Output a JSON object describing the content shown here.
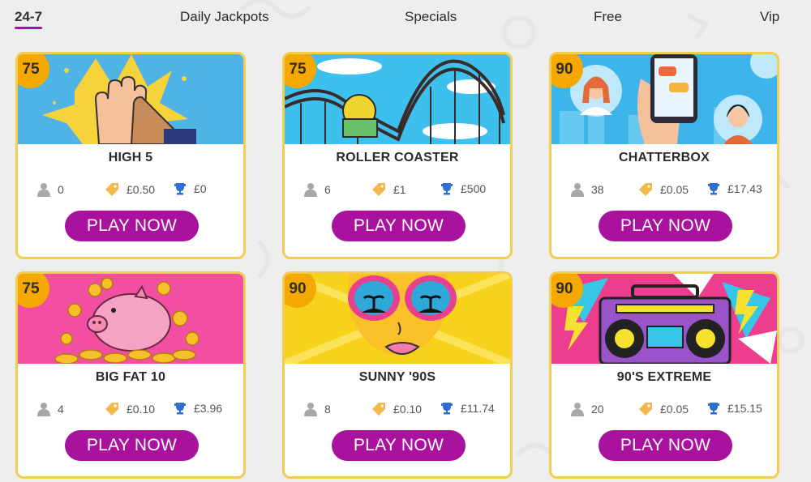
{
  "nav": {
    "items": [
      {
        "label": "24-7",
        "active": true
      },
      {
        "label": "Daily Jackpots",
        "active": false
      },
      {
        "label": "Specials",
        "active": false
      },
      {
        "label": "Free",
        "active": false
      },
      {
        "label": "Vip",
        "active": false
      }
    ]
  },
  "colors": {
    "accent": "#a8129d",
    "card_border": "#f1cd52",
    "badge": "#f5a800"
  },
  "icons": {
    "players": "person-icon",
    "price": "tag-icon",
    "prize": "trophy-icon"
  },
  "games": [
    {
      "badge": "75",
      "title": "HIGH 5",
      "players": "0",
      "price": "£0.50",
      "prize": "£0",
      "button": "PLAY NOW",
      "image": "high-five-illustration"
    },
    {
      "badge": "75",
      "title": "ROLLER COASTER",
      "players": "6",
      "price": "£1",
      "prize": "£500",
      "button": "PLAY NOW",
      "image": "roller-coaster-illustration"
    },
    {
      "badge": "90",
      "title": "CHATTERBOX",
      "players": "38",
      "price": "£0.05",
      "prize": "£17.43",
      "button": "PLAY NOW",
      "image": "chat-phone-illustration"
    },
    {
      "badge": "75",
      "title": "BIG FAT 10",
      "players": "4",
      "price": "£0.10",
      "prize": "£3.96",
      "button": "PLAY NOW",
      "image": "piggy-bank-illustration"
    },
    {
      "badge": "90",
      "title": "SUNNY '90S",
      "players": "8",
      "price": "£0.10",
      "prize": "£11.74",
      "button": "PLAY NOW",
      "image": "sunglasses-face-illustration"
    },
    {
      "badge": "90",
      "title": "90'S EXTREME",
      "players": "20",
      "price": "£0.05",
      "prize": "£15.15",
      "button": "PLAY NOW",
      "image": "boombox-illustration"
    }
  ]
}
